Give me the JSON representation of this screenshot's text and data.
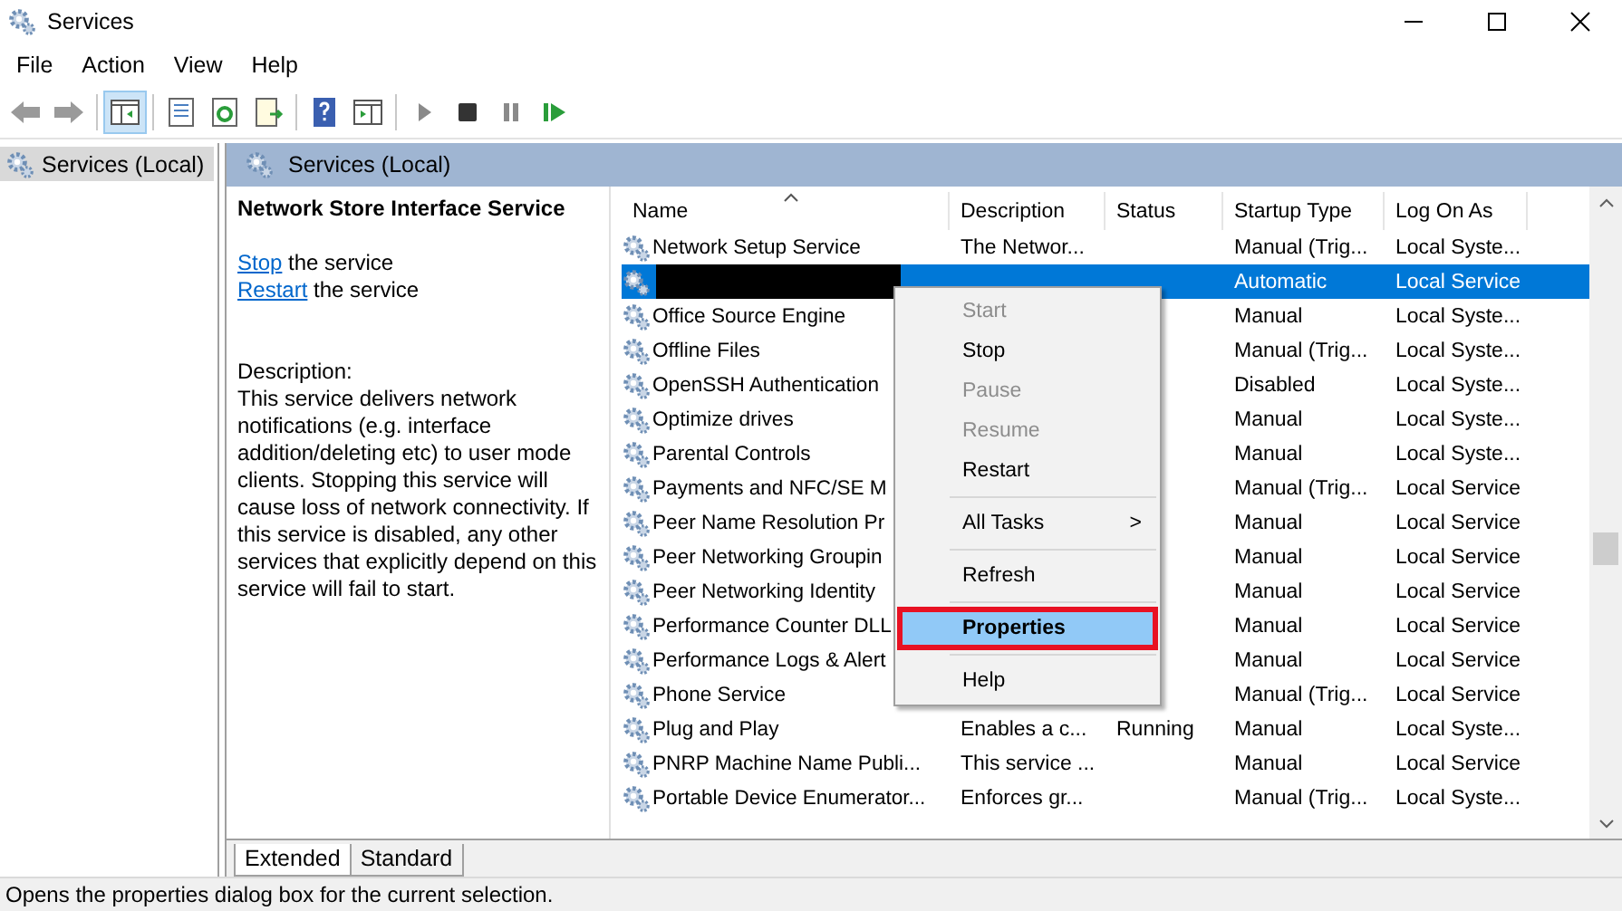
{
  "window": {
    "title": "Services"
  },
  "menu_bar": [
    {
      "label": "File"
    },
    {
      "label": "Action"
    },
    {
      "label": "View"
    },
    {
      "label": "Help"
    }
  ],
  "toolbar": [
    {
      "kind": "back"
    },
    {
      "kind": "forward"
    },
    {
      "kind": "separator"
    },
    {
      "kind": "console-tree",
      "pressed": true
    },
    {
      "kind": "separator"
    },
    {
      "kind": "properties",
      "pressed": false
    },
    {
      "kind": "refresh",
      "pressed": false
    },
    {
      "kind": "export",
      "pressed": false
    },
    {
      "kind": "separator"
    },
    {
      "kind": "help",
      "pressed": false
    },
    {
      "kind": "action-pane",
      "pressed": false
    },
    {
      "kind": "separator"
    },
    {
      "kind": "start"
    },
    {
      "kind": "stop"
    },
    {
      "kind": "pause"
    },
    {
      "kind": "resume"
    }
  ],
  "tree": {
    "items": [
      {
        "label": "Services (Local)",
        "selected": true
      }
    ]
  },
  "pane_header": {
    "title": "Services (Local)"
  },
  "details": {
    "service_name": "Network Store Interface Service",
    "actions": [
      {
        "link": "Stop",
        "text": "the service"
      },
      {
        "link": "Restart",
        "text": "the service"
      }
    ],
    "description_label": "Description:",
    "description": "This service delivers network notifications (e.g. interface addition/deleting etc) to user mode clients. Stopping this service will cause loss of network connectivity. If this service is disabled, any other services that explicitly depend on this service will fail to start."
  },
  "table": {
    "columns": [
      {
        "label": "Name",
        "sorted": true
      },
      {
        "label": "Description",
        "sorted": false
      },
      {
        "label": "Status",
        "sorted": false
      },
      {
        "label": "Startup Type",
        "sorted": false
      },
      {
        "label": "Log On As",
        "sorted": false
      }
    ],
    "rows": [
      {
        "name": "Network Setup Service",
        "description": "The Networ...",
        "status": "",
        "startup": "Manual (Trig...",
        "logon": "Local Syste...",
        "selected": false
      },
      {
        "name": "",
        "redacted": true,
        "description": "",
        "status": "",
        "startup": "Automatic",
        "logon": "Local Service",
        "selected": true
      },
      {
        "name": "Office  Source Engine",
        "description": "",
        "status": "",
        "startup": "Manual",
        "logon": "Local Syste...",
        "selected": false
      },
      {
        "name": "Offline Files",
        "description": "",
        "status": "",
        "startup": "Manual (Trig...",
        "logon": "Local Syste...",
        "selected": false
      },
      {
        "name": "OpenSSH Authentication",
        "description": "",
        "status": "",
        "startup": "Disabled",
        "logon": "Local Syste...",
        "selected": false
      },
      {
        "name": "Optimize drives",
        "description": "",
        "status": "",
        "startup": "Manual",
        "logon": "Local Syste...",
        "selected": false
      },
      {
        "name": "Parental Controls",
        "description": "",
        "status": "",
        "startup": "Manual",
        "logon": "Local Syste...",
        "selected": false
      },
      {
        "name": "Payments and NFC/SE M",
        "description": "",
        "status": "",
        "startup": "Manual (Trig...",
        "logon": "Local Service",
        "selected": false
      },
      {
        "name": "Peer Name Resolution Pr",
        "description": "",
        "status": "",
        "startup": "Manual",
        "logon": "Local Service",
        "selected": false
      },
      {
        "name": "Peer Networking Groupin",
        "description": "",
        "status": "",
        "startup": "Manual",
        "logon": "Local Service",
        "selected": false
      },
      {
        "name": "Peer Networking Identity",
        "description": "",
        "status": "",
        "startup": "Manual",
        "logon": "Local Service",
        "selected": false
      },
      {
        "name": "Performance Counter DLL",
        "description": "",
        "status": "",
        "startup": "Manual",
        "logon": "Local Service",
        "selected": false
      },
      {
        "name": "Performance Logs & Alert",
        "description": "",
        "status": "",
        "startup": "Manual",
        "logon": "Local Service",
        "selected": false
      },
      {
        "name": "Phone Service",
        "description": "",
        "status": "",
        "startup": "Manual (Trig...",
        "logon": "Local Service",
        "selected": false
      },
      {
        "name": "Plug and Play",
        "description": "Enables a c...",
        "status": "Running",
        "startup": "Manual",
        "logon": "Local Syste...",
        "selected": false
      },
      {
        "name": "PNRP Machine Name Publi...",
        "description": "This service ...",
        "status": "",
        "startup": "Manual",
        "logon": "Local Service",
        "selected": false
      },
      {
        "name": "Portable Device Enumerator...",
        "description": "Enforces gr...",
        "status": "",
        "startup": "Manual (Trig...",
        "logon": "Local Syste...",
        "selected": false
      }
    ]
  },
  "context_menu": {
    "items": [
      {
        "kind": "item",
        "label": "Start",
        "disabled": true,
        "selected": false
      },
      {
        "kind": "item",
        "label": "Stop",
        "disabled": false,
        "selected": false
      },
      {
        "kind": "item",
        "label": "Pause",
        "disabled": true,
        "selected": false
      },
      {
        "kind": "item",
        "label": "Resume",
        "disabled": true,
        "selected": false
      },
      {
        "kind": "item",
        "label": "Restart",
        "disabled": false,
        "selected": false
      },
      {
        "kind": "separator"
      },
      {
        "kind": "submenu",
        "label": "All Tasks",
        "arrow": ">",
        "disabled": false,
        "selected": false
      },
      {
        "kind": "separator"
      },
      {
        "kind": "item",
        "label": "Refresh",
        "disabled": false,
        "selected": false
      },
      {
        "kind": "separator"
      },
      {
        "kind": "item",
        "label": "Properties",
        "disabled": false,
        "selected": true,
        "bold": true,
        "outlined": true
      },
      {
        "kind": "separator"
      },
      {
        "kind": "item",
        "label": "Help",
        "disabled": false,
        "selected": false
      }
    ]
  },
  "view_tabs": [
    {
      "label": "Extended",
      "selected": true
    },
    {
      "label": "Standard",
      "selected": false
    }
  ],
  "status_bar": {
    "text": "Opens the properties dialog box for the current selection."
  }
}
